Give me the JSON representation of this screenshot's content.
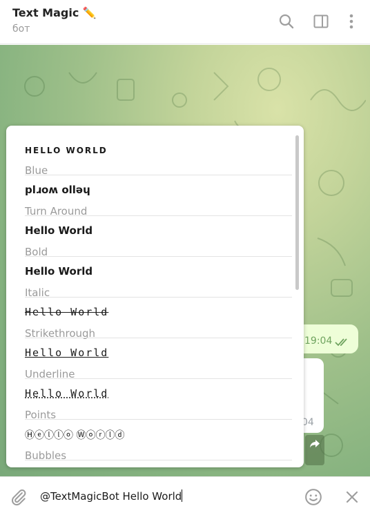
{
  "header": {
    "title": "Text Magic ✏️",
    "subtitle": "бот",
    "icons": [
      "search-icon",
      "sidebar-toggle-icon",
      "more-vertical-icon"
    ]
  },
  "chat": {
    "outgoing_time": "19:04",
    "incoming_time": "04"
  },
  "results": [
    {
      "title": "HELLO WORLD",
      "desc": "Blue"
    },
    {
      "title": "plɹoʍ ollǝɥ",
      "desc": "Turn Around"
    },
    {
      "title": "Hello World",
      "desc": "Bold"
    },
    {
      "title": "Hello World",
      "desc": "Italic"
    },
    {
      "title": "Hello World",
      "desc": "Strikethrough"
    },
    {
      "title": "Hello World",
      "desc": "Underline"
    },
    {
      "title": "Hello World",
      "desc": "Points"
    },
    {
      "title": "Ⓗⓔⓛⓛⓞ Ⓦⓞⓡⓛⓓ",
      "desc": "Bubbles"
    }
  ],
  "input": {
    "value": "@TextMagicBot Hello World"
  },
  "colors": {
    "accent": "#6fa35f",
    "icon_gray": "#9e9e9e",
    "popup_bg": "#ffffff"
  }
}
